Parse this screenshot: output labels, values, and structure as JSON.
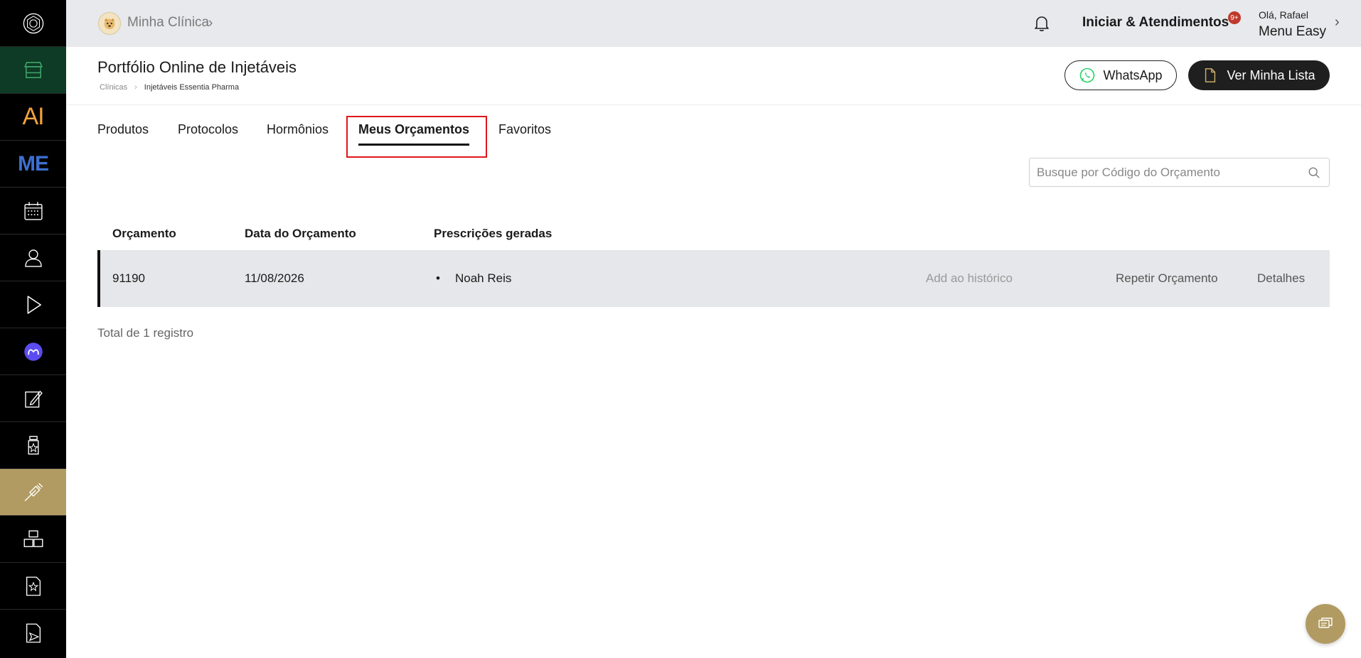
{
  "topbar": {
    "clinic_name": "Minha Clínica",
    "clinic_chevron": "›",
    "iniciar": "Iniciar & Atendimentos",
    "badge": "9+",
    "greeting": "Olá, Rafael",
    "menu_name": "Menu Easy",
    "chevron": "›"
  },
  "header": {
    "title": "Portfólio Online de Injetáveis",
    "breadcrumb": [
      "Clínicas",
      "Injetáveis Essentia Pharma"
    ],
    "breadcrumb_sep": "›",
    "whatsapp_label": "WhatsApp",
    "list_label": "Ver Minha Lista"
  },
  "tabs": [
    {
      "label": "Produtos"
    },
    {
      "label": "Protocolos"
    },
    {
      "label": "Hormônios"
    },
    {
      "label": "Meus Orçamentos",
      "active": true
    },
    {
      "label": "Favoritos"
    }
  ],
  "search": {
    "placeholder": "Busque por Código do Orçamento",
    "value": ""
  },
  "table": {
    "headers": [
      "Orçamento",
      "Data do Orçamento",
      "Prescrições geradas"
    ],
    "rows": [
      {
        "orcamento": "91190",
        "data": "11/08/2026",
        "bullet": "•",
        "prescricao": "Noah Reis",
        "add_historico": "Add ao histórico",
        "repetir": "Repetir Orçamento",
        "detalhes": "Detalhes"
      }
    ],
    "total": "Total de 1 registro"
  },
  "colors": {
    "sidebar_bg": "#000000",
    "active_sidebar": "#b29b62",
    "topbar_bg": "#e8e9ec",
    "highlight": "#e0161c",
    "row_bg": "#e6e7ea",
    "badge": "#c0392b"
  },
  "icons": {
    "sidebar": [
      "logo-icon",
      "store-icon",
      "ai-icon",
      "me-icon",
      "calendar-icon",
      "user-icon",
      "play-icon",
      "chat-bubble-icon",
      "edit-icon",
      "bottle-icon",
      "syringe-icon",
      "boxes-icon",
      "document-star-icon",
      "document-send-icon"
    ],
    "topbar": [
      "bell-icon"
    ],
    "buttons": [
      "whatsapp-icon",
      "document-icon"
    ],
    "search": "search-icon",
    "fab": "chat-icon"
  }
}
